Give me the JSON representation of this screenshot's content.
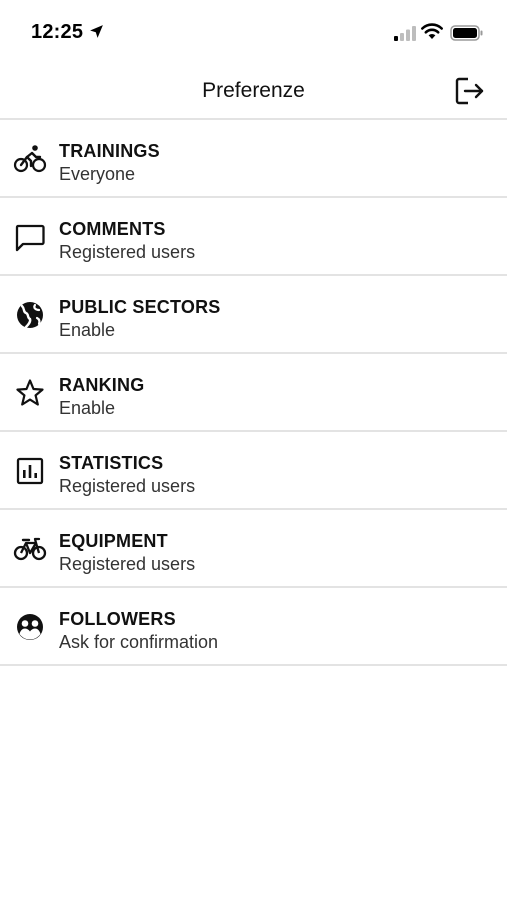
{
  "status_bar": {
    "time": "12:25",
    "icons": [
      "location-arrow-icon",
      "cellular-signal-icon",
      "wifi-icon",
      "battery-icon"
    ]
  },
  "header": {
    "title": "Preferenze",
    "logout_icon": "logout-icon"
  },
  "settings": [
    {
      "icon": "cyclist-icon",
      "title": "TRAININGS",
      "value": "Everyone"
    },
    {
      "icon": "comment-icon",
      "title": "COMMENTS",
      "value": "Registered users"
    },
    {
      "icon": "globe-icon",
      "title": "PUBLIC SECTORS",
      "value": "Enable"
    },
    {
      "icon": "star-icon",
      "title": "RANKING",
      "value": "Enable"
    },
    {
      "icon": "chart-icon",
      "title": "STATISTICS",
      "value": "Registered users"
    },
    {
      "icon": "bicycle-icon",
      "title": "EQUIPMENT",
      "value": "Registered users"
    },
    {
      "icon": "followers-icon",
      "title": "FOLLOWERS",
      "value": "Ask for confirmation"
    }
  ]
}
